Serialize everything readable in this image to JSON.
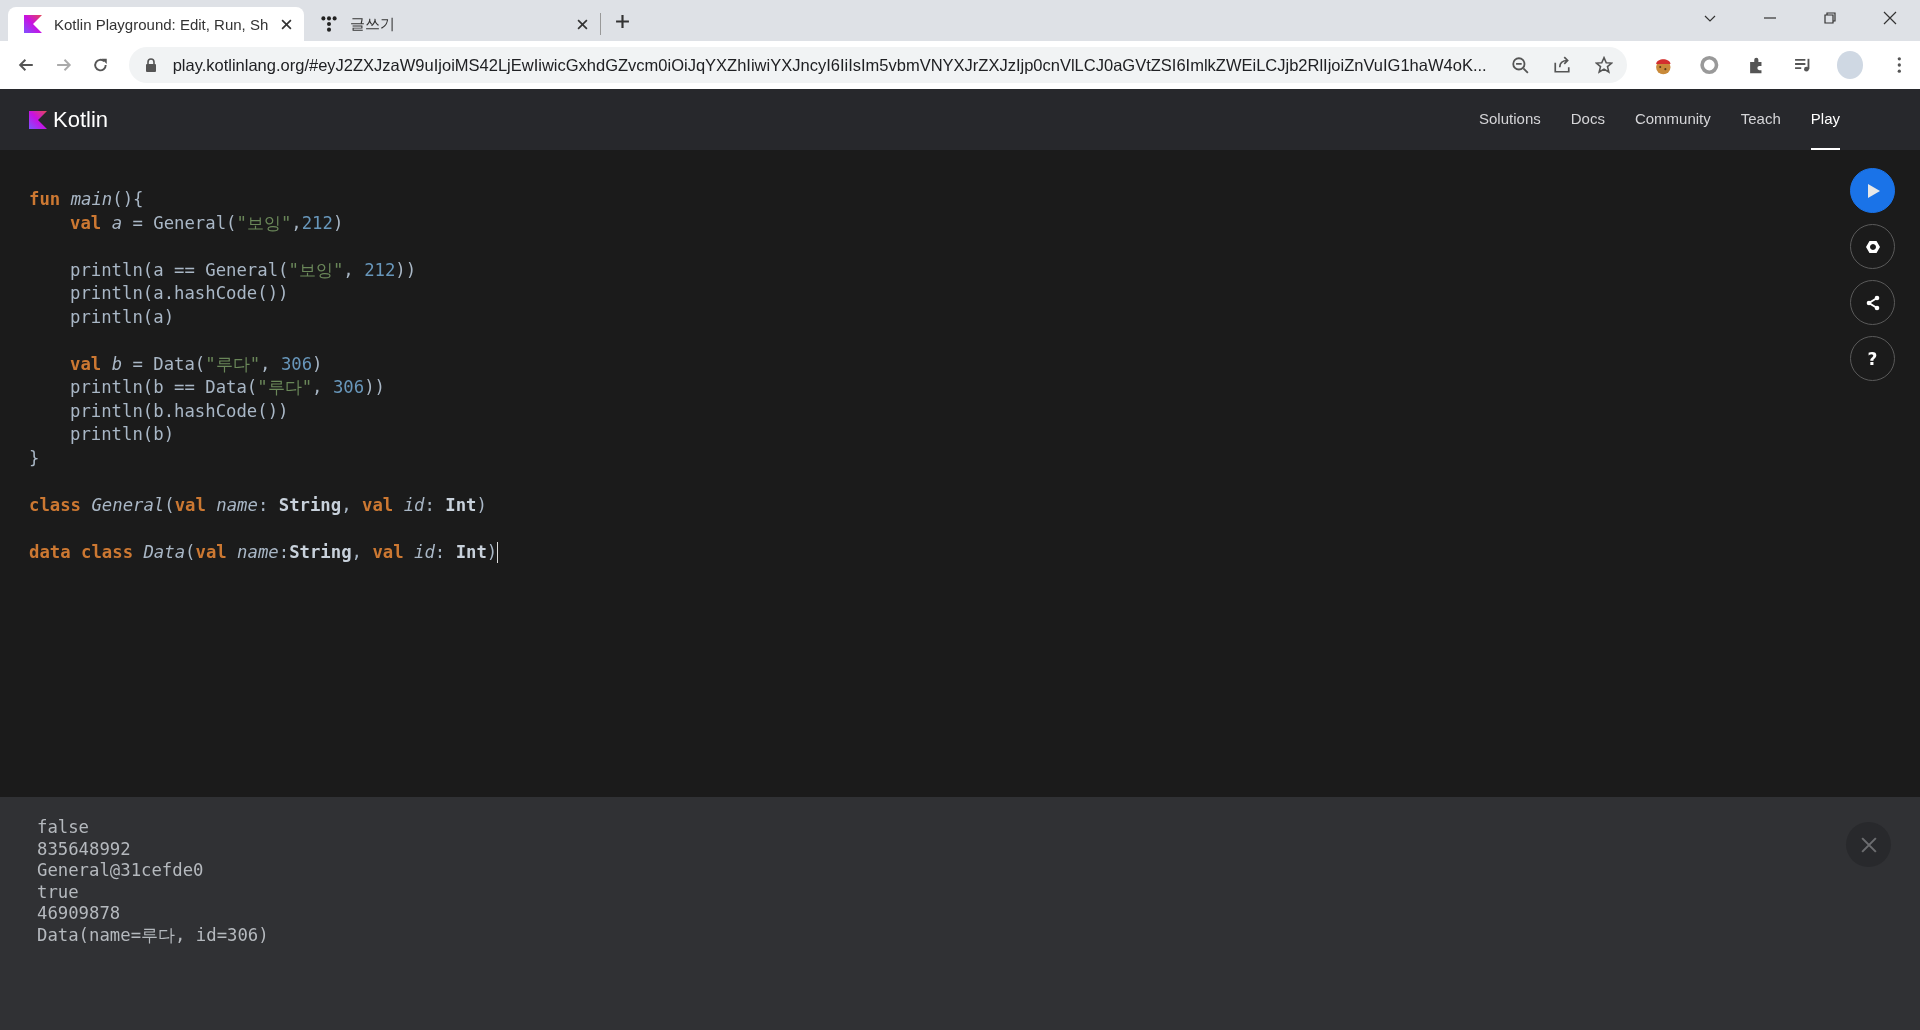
{
  "browser": {
    "tabs": [
      {
        "title": "Kotlin Playground: Edit, Run, Sh",
        "selected": true
      },
      {
        "title": "글쓰기",
        "selected": false
      }
    ],
    "url": "play.kotlinlang.org/#eyJ2ZXJzaW9uIjoiMS42LjEwIiwicGxhdGZvcm0iOiJqYXZhIiwiYXJncyI6IiIsIm5vbmVNYXJrZXJzIjp0cnVlLCJ0aGVtZSI6ImlkZWEiLCJjb2RlIjoiZnVuIG1haW4oK..."
  },
  "header": {
    "logo": "Kotlin",
    "nav": [
      {
        "label": "Solutions",
        "selected": false
      },
      {
        "label": "Docs",
        "selected": false
      },
      {
        "label": "Community",
        "selected": false
      },
      {
        "label": "Teach",
        "selected": false
      },
      {
        "label": "Play",
        "selected": true
      }
    ]
  },
  "editor": {
    "lines": [
      {
        "kind": "code",
        "indent": false,
        "cursor": false,
        "tokens": [
          {
            "kind": "kw",
            "text": "fun "
          },
          {
            "kind": "fn",
            "text": "main"
          },
          {
            "kind": "plain",
            "text": "(){"
          }
        ]
      },
      {
        "kind": "code",
        "indent": true,
        "cursor": false,
        "tokens": [
          {
            "kind": "kw",
            "text": "val "
          },
          {
            "kind": "fn",
            "text": "a"
          },
          {
            "kind": "plain",
            "text": " = General("
          },
          {
            "kind": "str",
            "text": "\"보잉\""
          },
          {
            "kind": "plain",
            "text": ","
          },
          {
            "kind": "num",
            "text": "212"
          },
          {
            "kind": "plain",
            "text": ")"
          }
        ]
      },
      {
        "kind": "blank"
      },
      {
        "kind": "code",
        "indent": true,
        "cursor": false,
        "tokens": [
          {
            "kind": "plain",
            "text": "println(a == General("
          },
          {
            "kind": "str",
            "text": "\"보잉\""
          },
          {
            "kind": "plain",
            "text": ", "
          },
          {
            "kind": "num",
            "text": "212"
          },
          {
            "kind": "plain",
            "text": "))"
          }
        ]
      },
      {
        "kind": "code",
        "indent": true,
        "cursor": false,
        "tokens": [
          {
            "kind": "plain",
            "text": "println(a.hashCode())"
          }
        ]
      },
      {
        "kind": "code",
        "indent": true,
        "cursor": false,
        "tokens": [
          {
            "kind": "plain",
            "text": "println(a)"
          }
        ]
      },
      {
        "kind": "blank"
      },
      {
        "kind": "code",
        "indent": true,
        "cursor": false,
        "tokens": [
          {
            "kind": "kw",
            "text": "val "
          },
          {
            "kind": "fn",
            "text": "b"
          },
          {
            "kind": "plain",
            "text": " = Data("
          },
          {
            "kind": "str",
            "text": "\"루다\""
          },
          {
            "kind": "plain",
            "text": ", "
          },
          {
            "kind": "num",
            "text": "306"
          },
          {
            "kind": "plain",
            "text": ")"
          }
        ]
      },
      {
        "kind": "code",
        "indent": true,
        "cursor": false,
        "tokens": [
          {
            "kind": "plain",
            "text": "println(b == Data("
          },
          {
            "kind": "str",
            "text": "\"루다\""
          },
          {
            "kind": "plain",
            "text": ", "
          },
          {
            "kind": "num",
            "text": "306"
          },
          {
            "kind": "plain",
            "text": "))"
          }
        ]
      },
      {
        "kind": "code",
        "indent": true,
        "cursor": false,
        "tokens": [
          {
            "kind": "plain",
            "text": "println(b.hashCode())"
          }
        ]
      },
      {
        "kind": "code",
        "indent": true,
        "cursor": false,
        "tokens": [
          {
            "kind": "plain",
            "text": "println(b)"
          }
        ]
      },
      {
        "kind": "code",
        "indent": false,
        "cursor": false,
        "tokens": [
          {
            "kind": "plain",
            "text": "}"
          }
        ]
      },
      {
        "kind": "blank"
      },
      {
        "kind": "code",
        "indent": false,
        "cursor": false,
        "tokens": [
          {
            "kind": "kw",
            "text": "class "
          },
          {
            "kind": "fn",
            "text": "General"
          },
          {
            "kind": "plain",
            "text": "("
          },
          {
            "kind": "kw",
            "text": "val "
          },
          {
            "kind": "fn",
            "text": "name"
          },
          {
            "kind": "plain",
            "text": ": "
          },
          {
            "kind": "type",
            "text": "String"
          },
          {
            "kind": "plain",
            "text": ", "
          },
          {
            "kind": "kw",
            "text": "val "
          },
          {
            "kind": "fn",
            "text": "id"
          },
          {
            "kind": "plain",
            "text": ": "
          },
          {
            "kind": "type",
            "text": "Int"
          },
          {
            "kind": "plain",
            "text": ")"
          }
        ]
      },
      {
        "kind": "blank"
      },
      {
        "kind": "code",
        "indent": false,
        "cursor": true,
        "tokens": [
          {
            "kind": "kw",
            "text": "data class "
          },
          {
            "kind": "fn",
            "text": "Data"
          },
          {
            "kind": "plain",
            "text": "("
          },
          {
            "kind": "kw",
            "text": "val "
          },
          {
            "kind": "fn",
            "text": "name"
          },
          {
            "kind": "plain",
            "text": ":"
          },
          {
            "kind": "type",
            "text": "String"
          },
          {
            "kind": "plain",
            "text": ", "
          },
          {
            "kind": "kw",
            "text": "val "
          },
          {
            "kind": "fn",
            "text": "id"
          },
          {
            "kind": "plain",
            "text": ": "
          },
          {
            "kind": "type",
            "text": "Int"
          },
          {
            "kind": "plain",
            "text": ")"
          }
        ]
      }
    ],
    "help_label": "?"
  },
  "output": {
    "lines": [
      "false",
      "835648992",
      "General@31cefde0",
      "true",
      "46909878",
      "Data(name=루다, id=306)"
    ]
  }
}
